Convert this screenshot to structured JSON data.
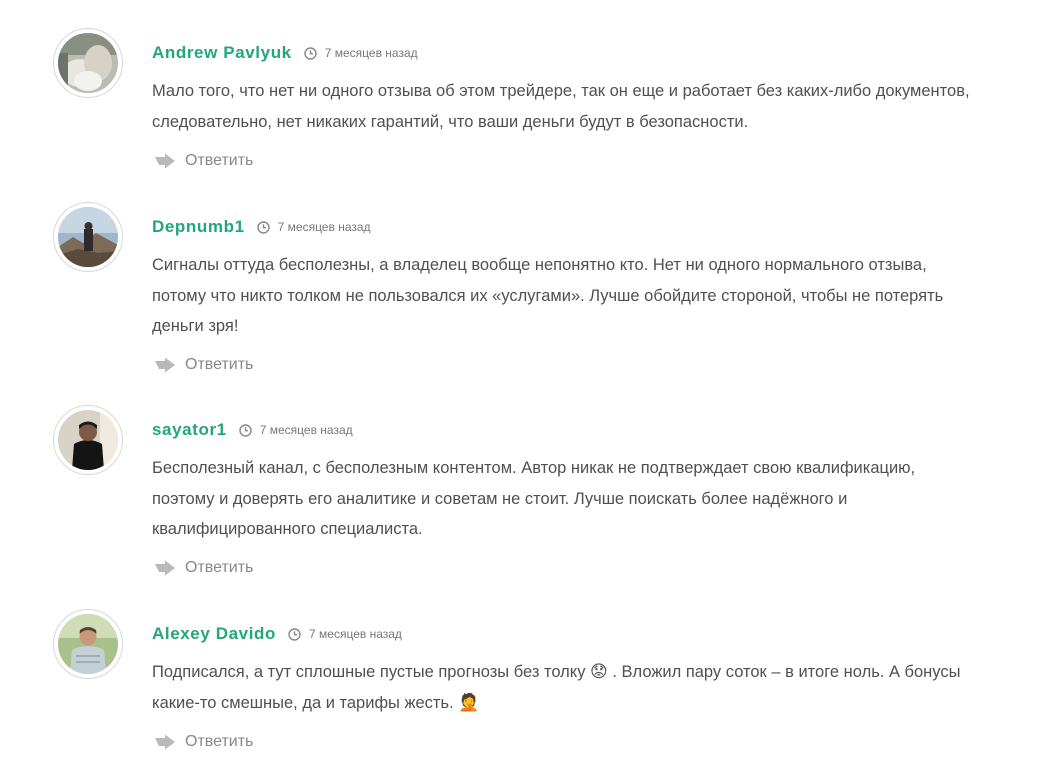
{
  "comments": [
    {
      "author": "Andrew Pavlyuk",
      "time": "7 месяцев назад",
      "text": "Мало того, что нет ни одного отзыва об этом трейдере, так он еще и работает без каких-либо документов, следовательно, нет никаких гарантий, что ваши деньги будут в безопасности.",
      "reply": "Ответить"
    },
    {
      "author": "Depnumb1",
      "time": "7 месяцев назад",
      "text": "Сигналы оттуда бесполезны, а владелец вообще непонятно кто. Нет ни одного нормального отзыва, потому что никто толком не пользовался их «услугами». Лучше обойдите стороной, чтобы не потерять деньги зря!",
      "reply": "Ответить"
    },
    {
      "author": "sayator1",
      "time": "7 месяцев назад",
      "text": "Бесполезный канал, с бесполезным контентом. Автор никак не подтверждает свою квалификацию, поэтому и доверять его аналитике и советам не стоит. Лучше поискать более надёжного и квалифицированного специалиста.",
      "reply": "Ответить"
    },
    {
      "author": "Alexey Davido",
      "time": "7 месяцев назад",
      "text_part1": "Подписался, а тут сплошные пустые прогнозы без толку",
      "emoji1": "😟",
      "text_part2": ". Вложил пару соток – в итоге ноль. А бонусы какие-то смешные, да и тарифы жесть.",
      "emoji2": "🤦",
      "reply": "Ответить"
    }
  ],
  "icons": {
    "clock": "clock-icon",
    "reply": "reply-arrow-icon"
  },
  "colors": {
    "author": "#22a67c",
    "meta": "#777777",
    "text": "#505050",
    "reply": "#888888"
  }
}
